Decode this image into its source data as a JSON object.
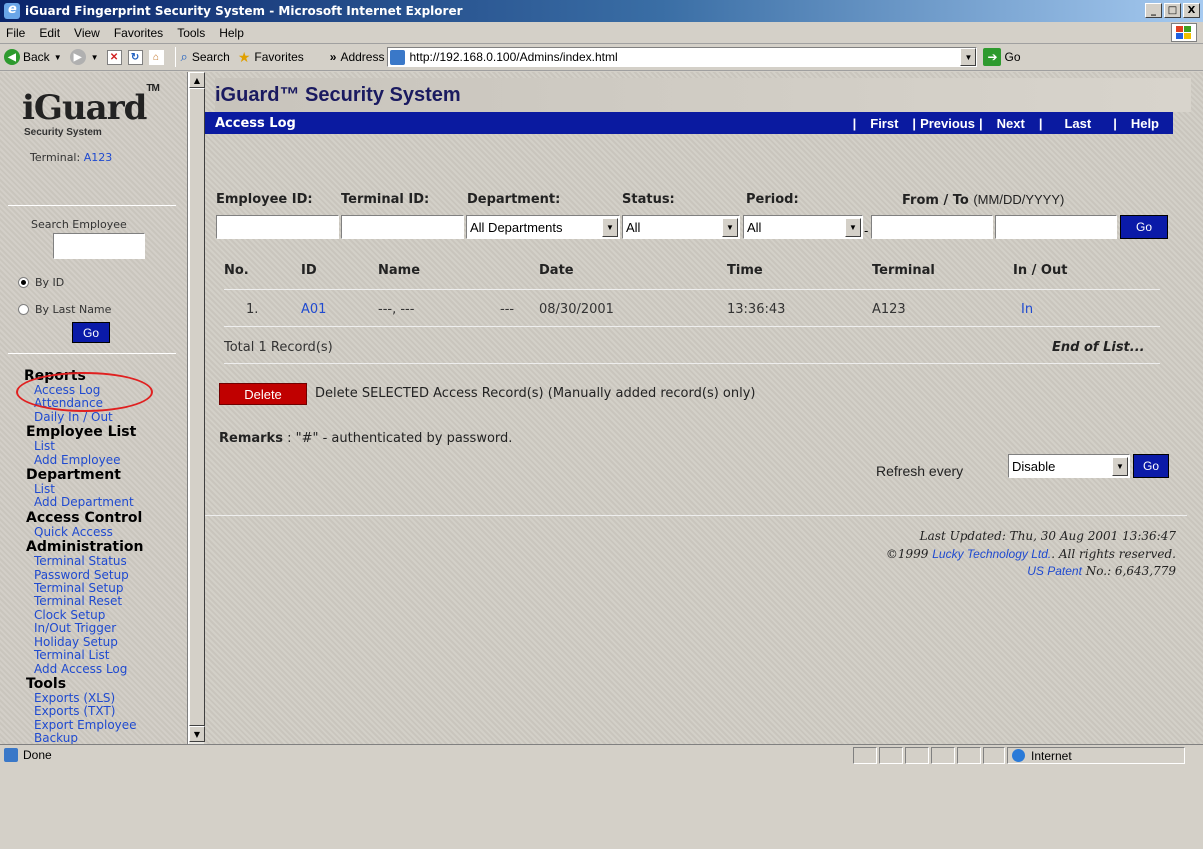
{
  "window": {
    "title": "iGuard Fingerprint Security System - Microsoft Internet Explorer",
    "minimize": "_",
    "maximize": "□",
    "close": "X"
  },
  "menu": [
    "File",
    "Edit",
    "View",
    "Favorites",
    "Tools",
    "Help"
  ],
  "toolbar": {
    "back": "Back",
    "search": "Search",
    "favorites": "Favorites",
    "chevron": "»",
    "address_label": "Address",
    "url": "http://192.168.0.100/Admins/index.html",
    "go": "Go"
  },
  "sidebar": {
    "logo": "iGuard",
    "logo_tm": "TM",
    "logo_sub": "Security System",
    "terminal_label": "Terminal:",
    "terminal_value": "A123",
    "search_label": "Search Employee",
    "radio_by_id": "By ID",
    "radio_by_last_name": "By Last Name",
    "go": "Go",
    "sections": [
      {
        "title": "Reports",
        "links": [
          "Access Log",
          "Attendance",
          "Daily In / Out"
        ]
      },
      {
        "title": "Employee List",
        "links": [
          "List",
          "Add Employee"
        ]
      },
      {
        "title": "Department",
        "links": [
          "List",
          "Add Department"
        ]
      },
      {
        "title": "Access Control",
        "links": [
          "Quick Access"
        ]
      },
      {
        "title": "Administration",
        "links": [
          "Terminal Status",
          "Password Setup",
          "Terminal Setup",
          "Terminal Reset",
          "Clock Setup",
          "In/Out Trigger",
          "Holiday Setup",
          "Terminal List",
          "Add Access Log"
        ]
      },
      {
        "title": "Tools",
        "links": [
          "Exports (XLS)",
          "Exports (TXT)",
          "Export Employee",
          "Backup"
        ]
      }
    ]
  },
  "main": {
    "title": "iGuard™ Security System",
    "bar_title": "Access Log",
    "nav": [
      "First",
      "Previous",
      "Next",
      "Last",
      "Help"
    ],
    "filters": {
      "employee_id": "Employee ID:",
      "terminal_id": "Terminal ID:",
      "department": "Department:",
      "status": "Status:",
      "period": "Period:",
      "from_to": "From / To",
      "date_format": "(MM/DD/YYYY)",
      "department_value": "All Departments",
      "status_value": "All",
      "period_value": "All",
      "go": "Go"
    },
    "table": {
      "headers": [
        "No.",
        "ID",
        "Name",
        "Date",
        "Time",
        "Terminal",
        "In / Out"
      ],
      "rows": [
        {
          "no": "1.",
          "id": "A01",
          "name": "---, ---",
          "dept": "---",
          "date": "08/30/2001",
          "time": "13:36:43",
          "terminal": "A123",
          "inout": "In"
        }
      ],
      "total": "Total 1 Record(s)",
      "end": "End of List..."
    },
    "delete_button": "Delete",
    "delete_text": "Delete SELECTED Access Record(s) (Manually added record(s) only)",
    "remarks_label": "Remarks",
    "remarks_text": " : \"#\" - authenticated by password.",
    "refresh_label": "Refresh every",
    "refresh_value": "Disable",
    "refresh_go": "Go",
    "footer": {
      "updated": "Last Updated: Thu, 30 Aug 2001 13:36:47",
      "copyright_prefix": "©1999",
      "company": "Lucky Technology Ltd.",
      "rights": ". All rights reserved.",
      "patent_link": "US Patent",
      "patent_no": " No.: 6,643,779"
    }
  },
  "status": {
    "text": "Done",
    "zone": "Internet"
  }
}
